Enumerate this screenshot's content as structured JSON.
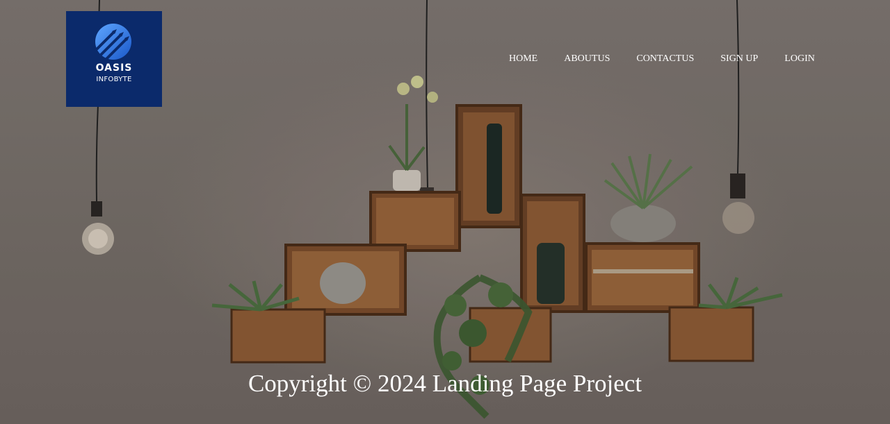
{
  "logo": {
    "title": "OASIS",
    "subtitle": "INFOBYTE",
    "bg_color": "#0b2a6b"
  },
  "nav": {
    "items": [
      {
        "label": "HOME"
      },
      {
        "label": "ABOUTUS"
      },
      {
        "label": "CONTACTUS"
      },
      {
        "label": "SIGN UP"
      },
      {
        "label": "LOGIN"
      }
    ]
  },
  "footer": {
    "copyright": "Copyright © 2024 Landing Page Project"
  },
  "background": {
    "description_icon": "hanging-bulbs-and-wooden-crate-shelves-photo"
  }
}
